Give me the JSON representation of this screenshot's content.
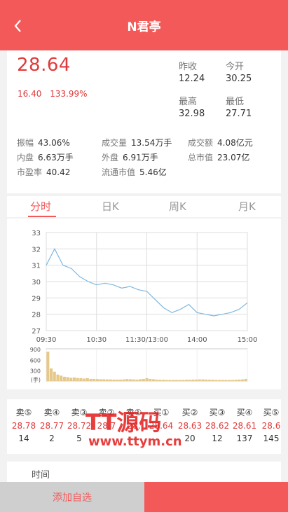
{
  "header": {
    "title": "N君亭"
  },
  "quote": {
    "price": "28.64",
    "change": "16.40",
    "change_pct": "133.99%",
    "prev_close": {
      "label": "昨收",
      "value": "12.24"
    },
    "open": {
      "label": "今开",
      "value": "30.25"
    },
    "high": {
      "label": "最高",
      "value": "32.98"
    },
    "low": {
      "label": "最低",
      "value": "27.71"
    },
    "stats": [
      {
        "label": "振幅",
        "value": "43.06%"
      },
      {
        "label": "成交量",
        "value": "13.54万手"
      },
      {
        "label": "成交额",
        "value": "4.08亿元"
      },
      {
        "label": "内盘",
        "value": "6.63万手"
      },
      {
        "label": "外盘",
        "value": "6.91万手"
      },
      {
        "label": "总市值",
        "value": "23.07亿"
      },
      {
        "label": "市盈率",
        "value": "40.42"
      },
      {
        "label": "流通市值",
        "value": "5.46亿"
      }
    ]
  },
  "tabs": [
    {
      "label": "分时"
    },
    {
      "label": "日K"
    },
    {
      "label": "周K"
    },
    {
      "label": "月K"
    }
  ],
  "colors": {
    "brand": "#f4595a",
    "up": "#e03a3a",
    "line": "#7fb8de",
    "volume": "#e6c98a"
  },
  "chart_data": [
    {
      "type": "line",
      "x": [
        "09:30",
        "09:40",
        "09:50",
        "10:00",
        "10:10",
        "10:20",
        "10:30",
        "10:40",
        "10:50",
        "11:00",
        "11:10",
        "11:20",
        "11:30/13:00",
        "13:10",
        "13:20",
        "13:30",
        "13:40",
        "13:50",
        "14:00",
        "14:10",
        "14:20",
        "14:30",
        "14:40",
        "14:50",
        "15:00"
      ],
      "series": [
        {
          "values": [
            31.0,
            32.0,
            31.0,
            30.8,
            30.3,
            30.0,
            29.8,
            29.9,
            29.8,
            29.6,
            29.7,
            29.5,
            29.4,
            28.9,
            28.4,
            28.1,
            28.3,
            28.6,
            28.1,
            28.0,
            27.9,
            28.0,
            28.1,
            28.3,
            28.7
          ]
        }
      ],
      "xticks": [
        "09:30",
        "10:30",
        "11:30/13:00",
        "14:00",
        "15:00"
      ],
      "yticks": [
        33,
        32,
        31,
        30,
        29,
        28,
        27
      ],
      "ylim": [
        27,
        33
      ],
      "grid": true
    },
    {
      "type": "bar",
      "yticks": [
        900,
        600,
        300
      ],
      "ylabel": "(手)",
      "ylim": [
        0,
        900
      ],
      "values": [
        820,
        350,
        260,
        180,
        150,
        120,
        110,
        90,
        100,
        85,
        80,
        70,
        80,
        60,
        60,
        55,
        50,
        50,
        45,
        45,
        40,
        40,
        40,
        45,
        55,
        50,
        45,
        40,
        50,
        60,
        80,
        60,
        50,
        40,
        35,
        35,
        30,
        30,
        30,
        30,
        30,
        30,
        35,
        35,
        40,
        40,
        45,
        45,
        40,
        35,
        35,
        30,
        30,
        30,
        30,
        30,
        30,
        35,
        40,
        45,
        60
      ]
    }
  ],
  "order_book": [
    {
      "label": "卖⑤",
      "price": "28.78",
      "volume": "14"
    },
    {
      "label": "卖④",
      "price": "28.77",
      "volume": "2"
    },
    {
      "label": "卖③",
      "price": "28.72",
      "volume": "5"
    },
    {
      "label": "卖②",
      "price": "28.7",
      "volume": ""
    },
    {
      "label": "卖①",
      "price": "28.",
      "volume": ""
    },
    {
      "label": "买①",
      "price": "28.64",
      "volume": ""
    },
    {
      "label": "买②",
      "price": "28.63",
      "volume": "20"
    },
    {
      "label": "买③",
      "price": "28.62",
      "volume": "12"
    },
    {
      "label": "买④",
      "price": "28.61",
      "volume": "137"
    },
    {
      "label": "买⑤",
      "price": "28.6",
      "volume": "145"
    }
  ],
  "trades": {
    "header": "时间"
  },
  "bottom": {
    "add_label": "添加自选"
  },
  "watermark": {
    "brand": "TT源码",
    "url": "www.ttym.cn"
  }
}
